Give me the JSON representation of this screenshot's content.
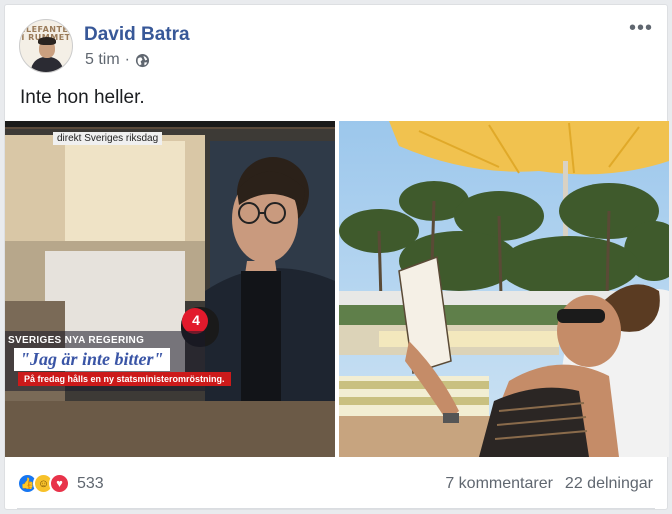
{
  "post": {
    "author": "David Batra",
    "time": "5 tim",
    "separator": "·",
    "privacy_icon": "globe-icon",
    "more_icon": "ellipsis-icon",
    "text": "Inte hon heller.",
    "avatar_text": "ELEFANTEN I RUMMET"
  },
  "photos": {
    "left": {
      "tv_label": "direkt Sveriges riksdag",
      "chyron_top": "SVERIGES NYA REGERING",
      "chyron_main": "\"Jag är inte bitter\"",
      "chyron_sub": "På fredag hålls en ny statsministeromröstning.",
      "channel_logo": "4"
    },
    "right": {}
  },
  "footer": {
    "reactions": [
      "like-icon",
      "haha-icon",
      "love-icon"
    ],
    "reaction_count": "533",
    "comments": "7 kommentarer",
    "shares": "22 delningar"
  },
  "colors": {
    "author": "#385898",
    "like": "#1877f2",
    "love": "#e8334a",
    "haha": "#f7c12a"
  }
}
